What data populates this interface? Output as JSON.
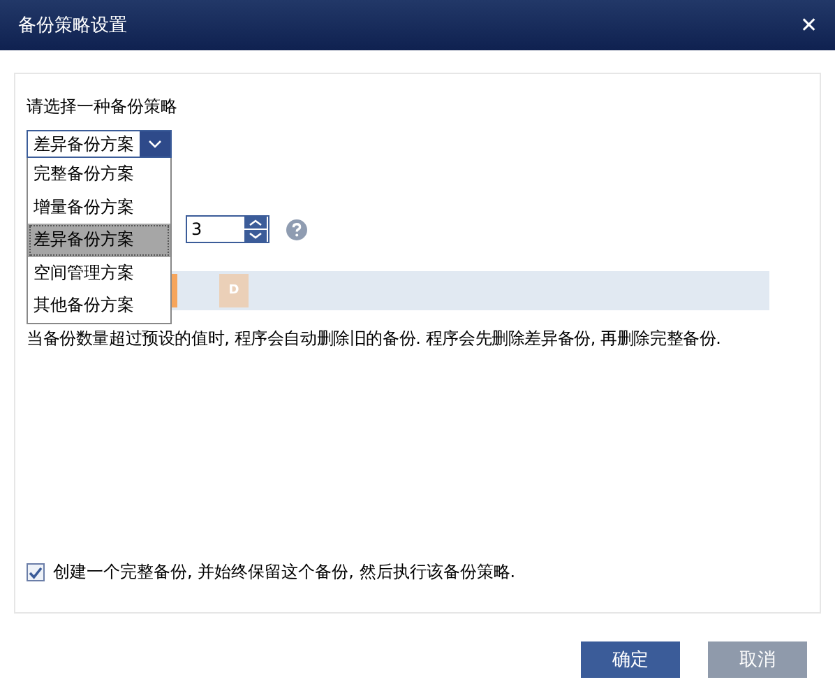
{
  "window": {
    "title": "备份策略设置",
    "close": "✕"
  },
  "prompt": "请选择一种备份策略",
  "scheme_select": {
    "value": "差异备份方案",
    "expanded": true,
    "options": [
      {
        "label": "完整备份方案",
        "selected": false
      },
      {
        "label": "增量备份方案",
        "selected": false
      },
      {
        "label": "差异备份方案",
        "selected": true
      },
      {
        "label": "空间管理方案",
        "selected": false
      },
      {
        "label": "其他备份方案",
        "selected": false
      }
    ]
  },
  "count_spinner": {
    "value": "3"
  },
  "backup_bar": {
    "blocks": [
      {
        "kind": "full"
      },
      {
        "kind": "differential",
        "label": "D"
      }
    ]
  },
  "description": "当备份数量超过预设的值时, 程序会自动删除旧的备份. 程序会先删除差异备份, 再删除完整备份.",
  "keep_full": {
    "label": "创建一个完整备份, 并始终保留这个备份, 然后执行该备份策略.",
    "checked": true
  },
  "buttons": [
    {
      "label": "确定",
      "disabled": false
    },
    {
      "label": "取消",
      "disabled": true
    }
  ]
}
